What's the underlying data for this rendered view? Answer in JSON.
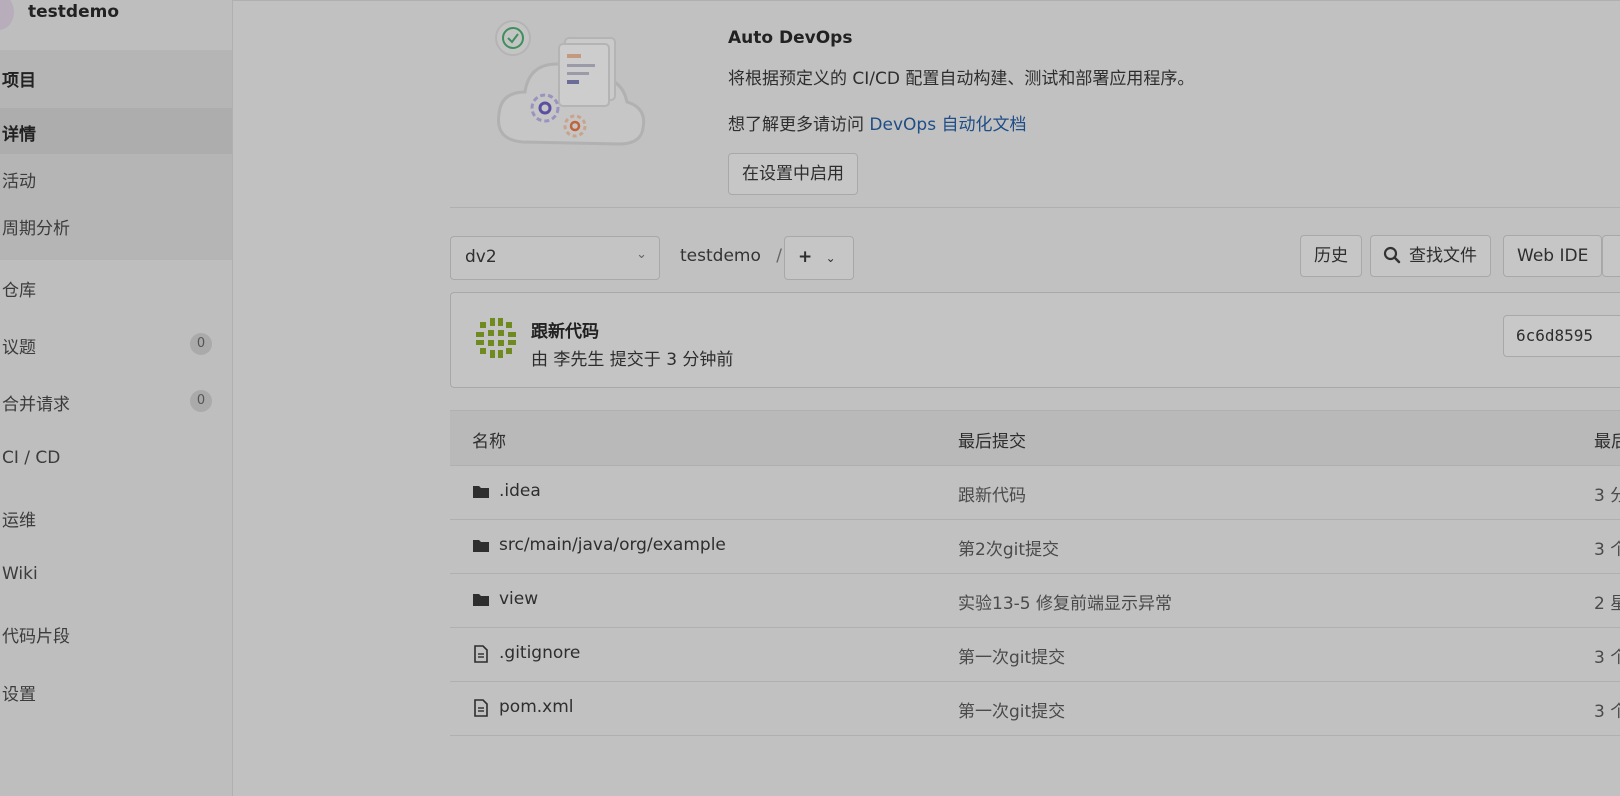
{
  "sidebar": {
    "project_name": "testdemo",
    "items": [
      {
        "label": "项目"
      },
      {
        "label": "详情"
      },
      {
        "label": "活动"
      },
      {
        "label": "周期分析"
      },
      {
        "label": "仓库"
      },
      {
        "label": "议题",
        "badge": "0"
      },
      {
        "label": "合并请求",
        "badge": "0"
      },
      {
        "label": "CI / CD"
      },
      {
        "label": "运维"
      },
      {
        "label": "Wiki"
      },
      {
        "label": "代码片段"
      },
      {
        "label": "设置"
      }
    ]
  },
  "devops": {
    "title": "Auto DevOps",
    "description": "将根据预定义的 CI/CD 配置自动构建、测试和部署应用程序。",
    "more_prefix": "想了解更多请访问 ",
    "more_link": "DevOps 自动化文档",
    "enable_button": "在设置中启用"
  },
  "toolbar": {
    "branch": "dv2",
    "breadcrumb_project": "testdemo",
    "breadcrumb_sep": "/",
    "plus_label": "+",
    "history_button": "历史",
    "find_file_button": "查找文件",
    "web_ide_button": "Web IDE"
  },
  "commit": {
    "title": "跟新代码",
    "meta": "由 李先生 提交于 3 分钟前",
    "sha": "6c6d8595"
  },
  "files": {
    "headers": [
      "名称",
      "最后提交",
      "最后"
    ],
    "rows": [
      {
        "type": "folder",
        "name": ".idea",
        "message": "跟新代码",
        "time": "3 分"
      },
      {
        "type": "folder",
        "name": "src/main/java/org/example",
        "message": "第2次git提交",
        "time": "3 个"
      },
      {
        "type": "folder",
        "name": "view",
        "message": "实验13-5 修复前端显示异常",
        "time": "2 星"
      },
      {
        "type": "file",
        "name": ".gitignore",
        "message": "第一次git提交",
        "time": "3 个"
      },
      {
        "type": "file",
        "name": "pom.xml",
        "message": "第一次git提交",
        "time": "3 个"
      }
    ]
  },
  "colors": {
    "link": "#1f4d86",
    "commit_avatar": "#6f8a1e",
    "illustration_check": "#3e8f5c"
  }
}
